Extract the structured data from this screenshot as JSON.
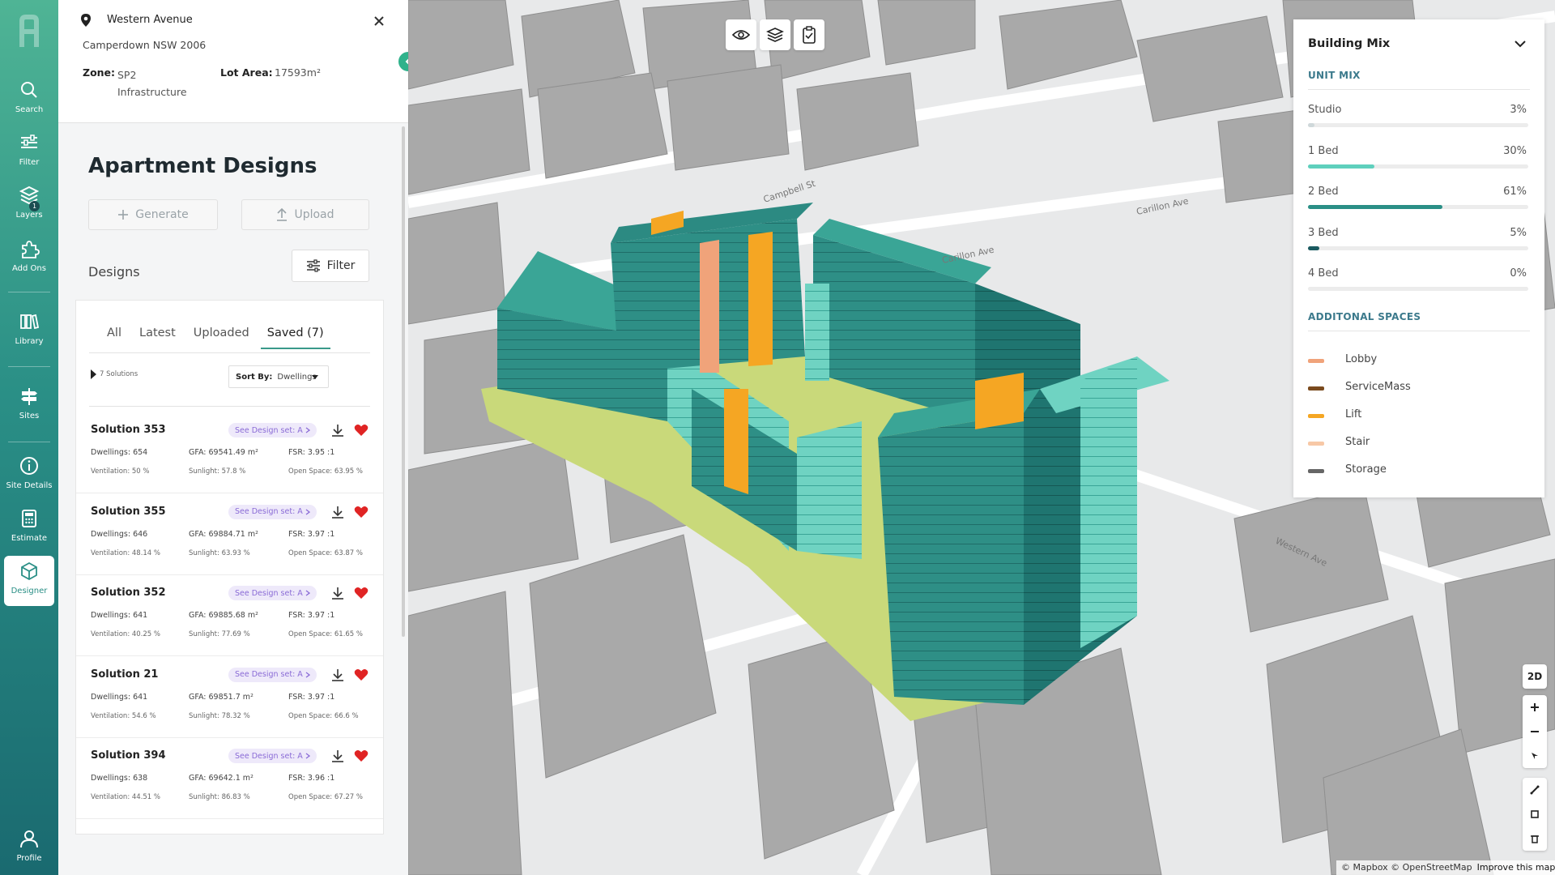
{
  "rail": {
    "items": [
      {
        "label": "Search",
        "icon": "search-icon"
      },
      {
        "label": "Filter",
        "icon": "sliders-icon"
      },
      {
        "label": "Layers",
        "icon": "layers-icon",
        "badge": "1"
      },
      {
        "label": "Add Ons",
        "icon": "puzzle-icon"
      },
      {
        "label": "Library",
        "icon": "library-icon"
      },
      {
        "label": "Sites",
        "icon": "signpost-icon"
      },
      {
        "label": "Site Details",
        "icon": "info-icon"
      },
      {
        "label": "Estimate",
        "icon": "calculator-icon"
      },
      {
        "label": "Designer",
        "icon": "cube-icon"
      },
      {
        "label": "Profile",
        "icon": "user-icon"
      }
    ]
  },
  "site": {
    "street": "Western Avenue",
    "suburb": "Camperdown NSW 2006",
    "zone_label": "Zone:",
    "zone_value": "SP2 Infrastructure",
    "lot_label": "Lot Area:",
    "lot_value": "17593m²"
  },
  "designs_panel": {
    "title": "Apartment Designs",
    "generate_label": "Generate",
    "upload_label": "Upload",
    "designs_label": "Designs",
    "filter_label": "Filter",
    "tabs": [
      "All",
      "Latest",
      "Uploaded",
      "Saved (7)"
    ],
    "active_tab": "Saved (7)",
    "solutions_count": "7 Solutions",
    "sort_label": "Sort By:",
    "sort_value": "Dwellings",
    "see_set_label": "See Design set: A",
    "solutions": [
      {
        "name": "Solution 353",
        "dwellings": "Dwellings: 654",
        "gfa": "GFA: 69541.49 m²",
        "fsr": "FSR: 3.95 :1",
        "ventilation": "Ventilation: 50 %",
        "sunlight": "Sunlight: 57.8 %",
        "open_space": "Open Space: 63.95 %"
      },
      {
        "name": "Solution 355",
        "dwellings": "Dwellings: 646",
        "gfa": "GFA: 69884.71 m²",
        "fsr": "FSR: 3.97 :1",
        "ventilation": "Ventilation: 48.14 %",
        "sunlight": "Sunlight: 63.93 %",
        "open_space": "Open Space: 63.87 %"
      },
      {
        "name": "Solution 352",
        "dwellings": "Dwellings: 641",
        "gfa": "GFA: 69885.68 m²",
        "fsr": "FSR: 3.97 :1",
        "ventilation": "Ventilation: 40.25 %",
        "sunlight": "Sunlight: 77.69 %",
        "open_space": "Open Space: 61.65 %"
      },
      {
        "name": "Solution 21",
        "dwellings": "Dwellings: 641",
        "gfa": "GFA: 69851.7 m²",
        "fsr": "FSR: 3.97 :1",
        "ventilation": "Ventilation: 54.6 %",
        "sunlight": "Sunlight: 78.32 %",
        "open_space": "Open Space: 66.6 %"
      },
      {
        "name": "Solution 394",
        "dwellings": "Dwellings: 638",
        "gfa": "GFA: 69642.1 m²",
        "fsr": "FSR: 3.96 :1",
        "ventilation": "Ventilation: 44.51 %",
        "sunlight": "Sunlight: 86.83 %",
        "open_space": "Open Space: 67.27 %"
      }
    ]
  },
  "building_mix": {
    "title": "Building Mix",
    "unit_mix_label": "UNIT MIX",
    "units": [
      {
        "label": "Studio",
        "value": "3%",
        "fraction": 0.03,
        "color": "#cfd8da"
      },
      {
        "label": "1 Bed",
        "value": "30%",
        "fraction": 0.3,
        "color": "#5fd0bd"
      },
      {
        "label": "2 Bed",
        "value": "61%",
        "fraction": 0.61,
        "color": "#2a8f86"
      },
      {
        "label": "3 Bed",
        "value": "5%",
        "fraction": 0.05,
        "color": "#1a5a60"
      },
      {
        "label": "4 Bed",
        "value": "0%",
        "fraction": 0.0,
        "color": "#1a5a60"
      }
    ],
    "additional_label": "ADDITONAL SPACES",
    "spaces": [
      {
        "label": "Lobby",
        "color": "#f0a37a"
      },
      {
        "label": "ServiceMass",
        "color": "#7a4a1e"
      },
      {
        "label": "Lift",
        "color": "#f5a623"
      },
      {
        "label": "Stair",
        "color": "#f7c8a6"
      },
      {
        "label": "Storage",
        "color": "#666666"
      }
    ]
  },
  "map": {
    "street_labels": [
      "Campbell St",
      "Carillon Ave",
      "Carillon Ave",
      "Western Ave"
    ],
    "controls": [
      "2D"
    ],
    "attribution": "© Mapbox © OpenStreetMap",
    "improve": "Improve this map"
  }
}
